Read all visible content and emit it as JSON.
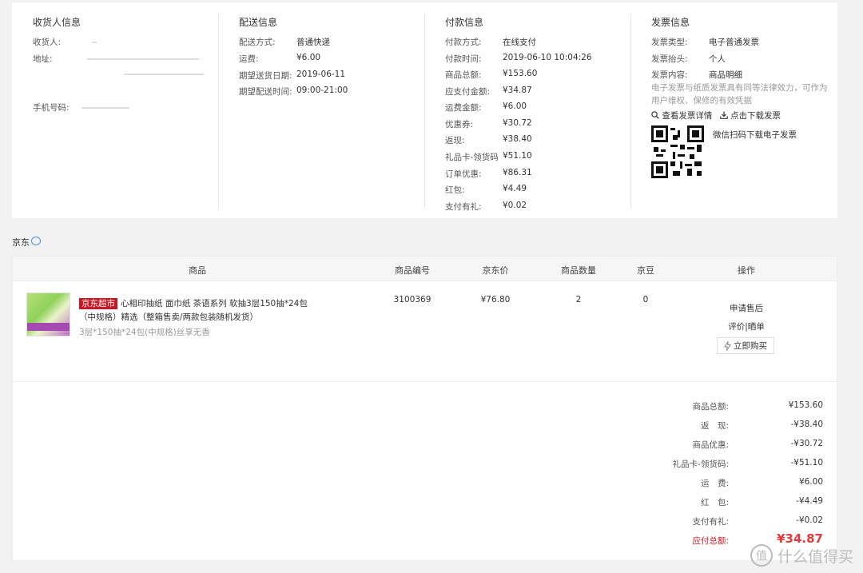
{
  "consignee": {
    "title": "收货人信息",
    "name_label": "收货人:",
    "address_label": "地址:",
    "phone_label": "手机号码:"
  },
  "delivery": {
    "title": "配送信息",
    "rows": [
      {
        "k": "配送方式:",
        "v": "普通快递"
      },
      {
        "k": "运费:",
        "v": "¥6.00"
      },
      {
        "k": "期望送货日期:",
        "v": "2019-06-11"
      },
      {
        "k": "期望配送时间:",
        "v": "09:00-21:00"
      }
    ]
  },
  "payment": {
    "title": "付款信息",
    "rows": [
      {
        "k": "付款方式:",
        "v": "在线支付"
      },
      {
        "k": "付款时间:",
        "v": "2019-06-10 10:04:26"
      },
      {
        "k": "商品总额:",
        "v": "¥153.60"
      },
      {
        "k": "应支付金额:",
        "v": "¥34.87"
      },
      {
        "k": "运费金额:",
        "v": "¥6.00"
      },
      {
        "k": "优惠券:",
        "v": "¥30.72"
      },
      {
        "k": "返现:",
        "v": "¥38.40"
      },
      {
        "k": "礼品卡-领货码",
        "v": "¥51.10"
      },
      {
        "k": "订单优惠:",
        "v": "¥86.31"
      },
      {
        "k": "红包:",
        "v": "¥4.49"
      },
      {
        "k": "支付有礼:",
        "v": "¥0.02"
      }
    ]
  },
  "invoice": {
    "title": "发票信息",
    "rows": [
      {
        "k": "发票类型:",
        "v": "电子普通发票"
      },
      {
        "k": "发票抬头:",
        "v": "个人"
      },
      {
        "k": "发票内容:",
        "v": "商品明细"
      }
    ],
    "note": "电子发票与纸质发票具有同等法律效力，可作为用户维权、保修的有效凭据",
    "view_label": "查看发票详情",
    "download_label": "点击下载发票",
    "qr_caption": "微信扫码下载电子发票"
  },
  "shop": {
    "name": "京东"
  },
  "table": {
    "headers": {
      "product": "商品",
      "sku": "商品编号",
      "price": "京东价",
      "qty": "商品数量",
      "beans": "京豆",
      "ops": "操作"
    },
    "item": {
      "tag": "京东超市",
      "title": "心相印抽纸 面巾纸 茶语系列 软抽3层150抽*24包（中规格）精选（整箱售卖/两款包装随机发货）",
      "spec": "3层*150抽*24包(中规格)丝享无香",
      "sku": "3100369",
      "price": "¥76.80",
      "qty": "2",
      "beans": "0",
      "op_after_sale": "申请售后",
      "op_review": "评价|晒单",
      "op_buy_again": "立即购买"
    }
  },
  "summary": [
    {
      "label": "商品总额:",
      "value": "¥153.60"
    },
    {
      "label": "返　现:",
      "value": "-¥38.40"
    },
    {
      "label": "商品优惠:",
      "value": "-¥30.72"
    },
    {
      "label": "礼品卡-领货码:",
      "value": "-¥51.10"
    },
    {
      "label": "运　费:",
      "value": "¥6.00"
    },
    {
      "label": "红　包:",
      "value": "-¥4.49"
    },
    {
      "label": "支付有礼:",
      "value": "-¥0.02"
    }
  ],
  "total": {
    "label": "应付总额:",
    "value": "¥34.87"
  },
  "watermark": {
    "text": "什么值得买",
    "glyph": "值"
  },
  "colors": {
    "accent_red": "#e4393c",
    "tag_red": "#c91623",
    "link_blue": "#4a90e2"
  }
}
